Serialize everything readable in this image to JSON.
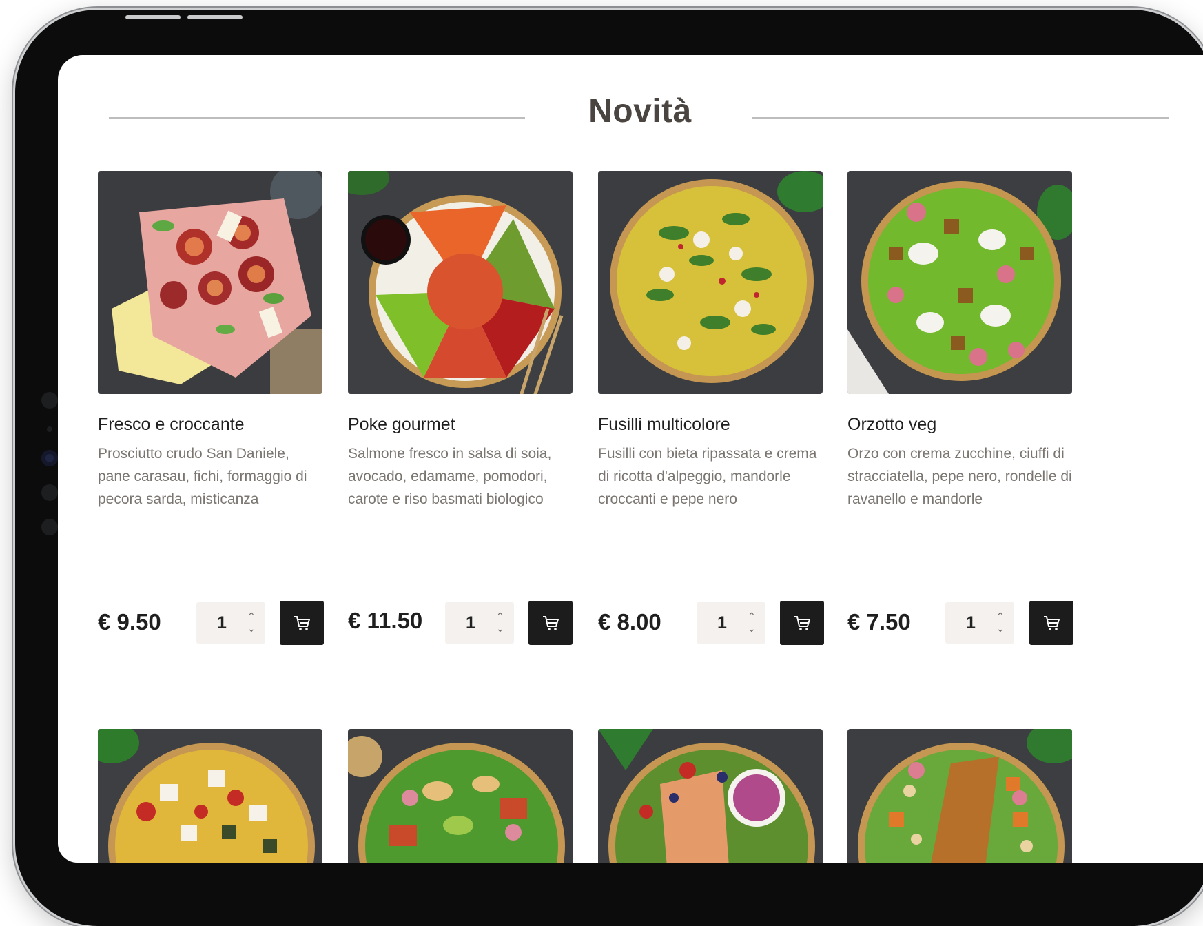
{
  "section": {
    "title": "Novità"
  },
  "products": [
    {
      "name": "Fresco e croccante",
      "description": "Prosciutto crudo San Daniele, pane carasau, fichi, formaggio di pecora sarda, misticanza",
      "price": "€ 9.50",
      "quantity": "1",
      "photo_icon": "fig-prosciutto-plate"
    },
    {
      "name": "Poke gourmet",
      "description": "Salmone fresco in salsa di soia, avocado, edamame, pomodori, carote e riso basmati biologico",
      "price": "€ 11.50",
      "quantity": "1",
      "photo_icon": "poke-bowl"
    },
    {
      "name": "Fusilli multicolore",
      "description": "Fusilli con bieta ripassata e crema di ricotta d'alpeggio, mandorle croccanti e pepe nero",
      "price": "€ 8.00",
      "quantity": "1",
      "photo_icon": "fusilli-bowl"
    },
    {
      "name": "Orzotto veg",
      "description": "Orzo con crema zucchine, ciuffi di stracciatella, pepe nero, rondelle di ravanello e mandorle",
      "price": "€ 7.50",
      "quantity": "1",
      "photo_icon": "orzotto-bowl"
    }
  ],
  "icons": {
    "cart": "shopping-cart-icon",
    "stepper_up": "chevron-up-icon",
    "stepper_down": "chevron-down-icon"
  },
  "colors": {
    "title": "#4a4540",
    "description": "#7a7570",
    "cart_button": "#1c1c1c",
    "stepper_bg": "#f4f1ee"
  }
}
